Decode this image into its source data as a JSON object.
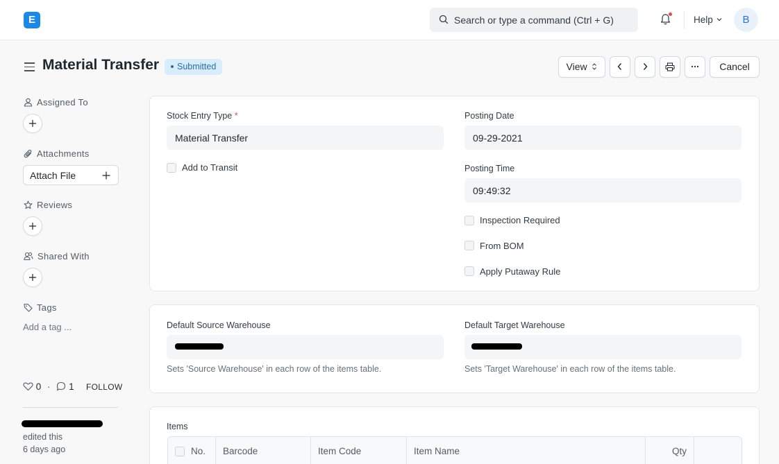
{
  "navbar": {
    "logo_letter": "E",
    "search_placeholder": "Search or type a command (Ctrl + G)",
    "help_label": "Help",
    "avatar_initial": "B"
  },
  "page": {
    "title": "Material Transfer",
    "status": "Submitted",
    "status_color": "#2b6ea8"
  },
  "toolbar": {
    "view_label": "View",
    "view_chevron": "⌃⌄",
    "cancel_label": "Cancel"
  },
  "sidebar": {
    "assigned_to": "Assigned To",
    "attachments": "Attachments",
    "attach_file": "Attach File",
    "reviews": "Reviews",
    "shared_with": "Shared With",
    "tags": "Tags",
    "add_tag": "Add a tag ...",
    "likes": "0",
    "separator": "·",
    "comments": "1",
    "follow": "FOLLOW",
    "edited_action": "edited this",
    "edited_time": "6 days ago"
  },
  "form": {
    "stock_entry_type_label": "Stock Entry Type",
    "required_mark": "*",
    "stock_entry_type_value": "Material Transfer",
    "add_to_transit_label": "Add to Transit",
    "posting_date_label": "Posting Date",
    "posting_date_value": "09-29-2021",
    "posting_time_label": "Posting Time",
    "posting_time_value": "09:49:32",
    "inspection_required_label": "Inspection Required",
    "from_bom_label": "From BOM",
    "apply_putaway_label": "Apply Putaway Rule"
  },
  "warehouses": {
    "source_label": "Default Source Warehouse",
    "source_help": "Sets 'Source Warehouse' in each row of the items table.",
    "target_label": "Default Target Warehouse",
    "target_help": "Sets 'Target Warehouse' in each row of the items table."
  },
  "items": {
    "section_label": "Items",
    "columns": [
      "No.",
      "Barcode",
      "Item Code",
      "Item Name",
      "Qty"
    ]
  }
}
